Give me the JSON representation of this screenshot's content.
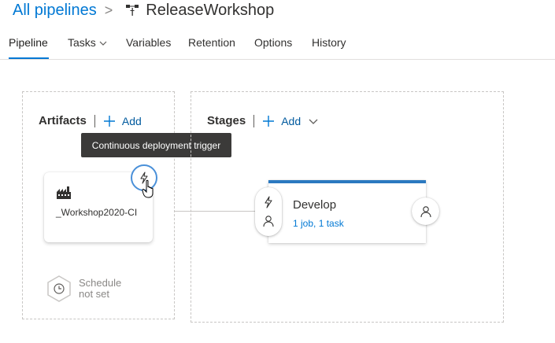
{
  "breadcrumb": {
    "root_label": "All pipelines",
    "separator": ">",
    "pipeline_name": "ReleaseWorkshop",
    "pipeline_icon": "release-pipeline-icon"
  },
  "tabs": [
    {
      "label": "Pipeline",
      "active": true
    },
    {
      "label": "Tasks",
      "has_dropdown": true
    },
    {
      "label": "Variables"
    },
    {
      "label": "Retention"
    },
    {
      "label": "Options"
    },
    {
      "label": "History"
    }
  ],
  "artifacts": {
    "title": "Artifacts",
    "add_label": "Add",
    "tooltip": "Continuous deployment trigger",
    "card": {
      "name": "_Workshop2020-CI",
      "icon": "build-factory-icon"
    },
    "trigger_icon": "lightning-icon",
    "schedule": {
      "line1": "Schedule",
      "line2": "not set",
      "icon": "clock-icon"
    }
  },
  "stages": {
    "title": "Stages",
    "add_label": "Add",
    "stage": {
      "name": "Develop",
      "summary": "1 job, 1 task",
      "pre_icons": [
        "lightning-icon",
        "person-icon"
      ],
      "post_icon": "person-icon"
    }
  },
  "colors": {
    "accent": "#0078d4",
    "stage_bar": "#2b79c0",
    "tooltip_bg": "#3b3a39",
    "trigger_ring": "#4a90d9"
  }
}
